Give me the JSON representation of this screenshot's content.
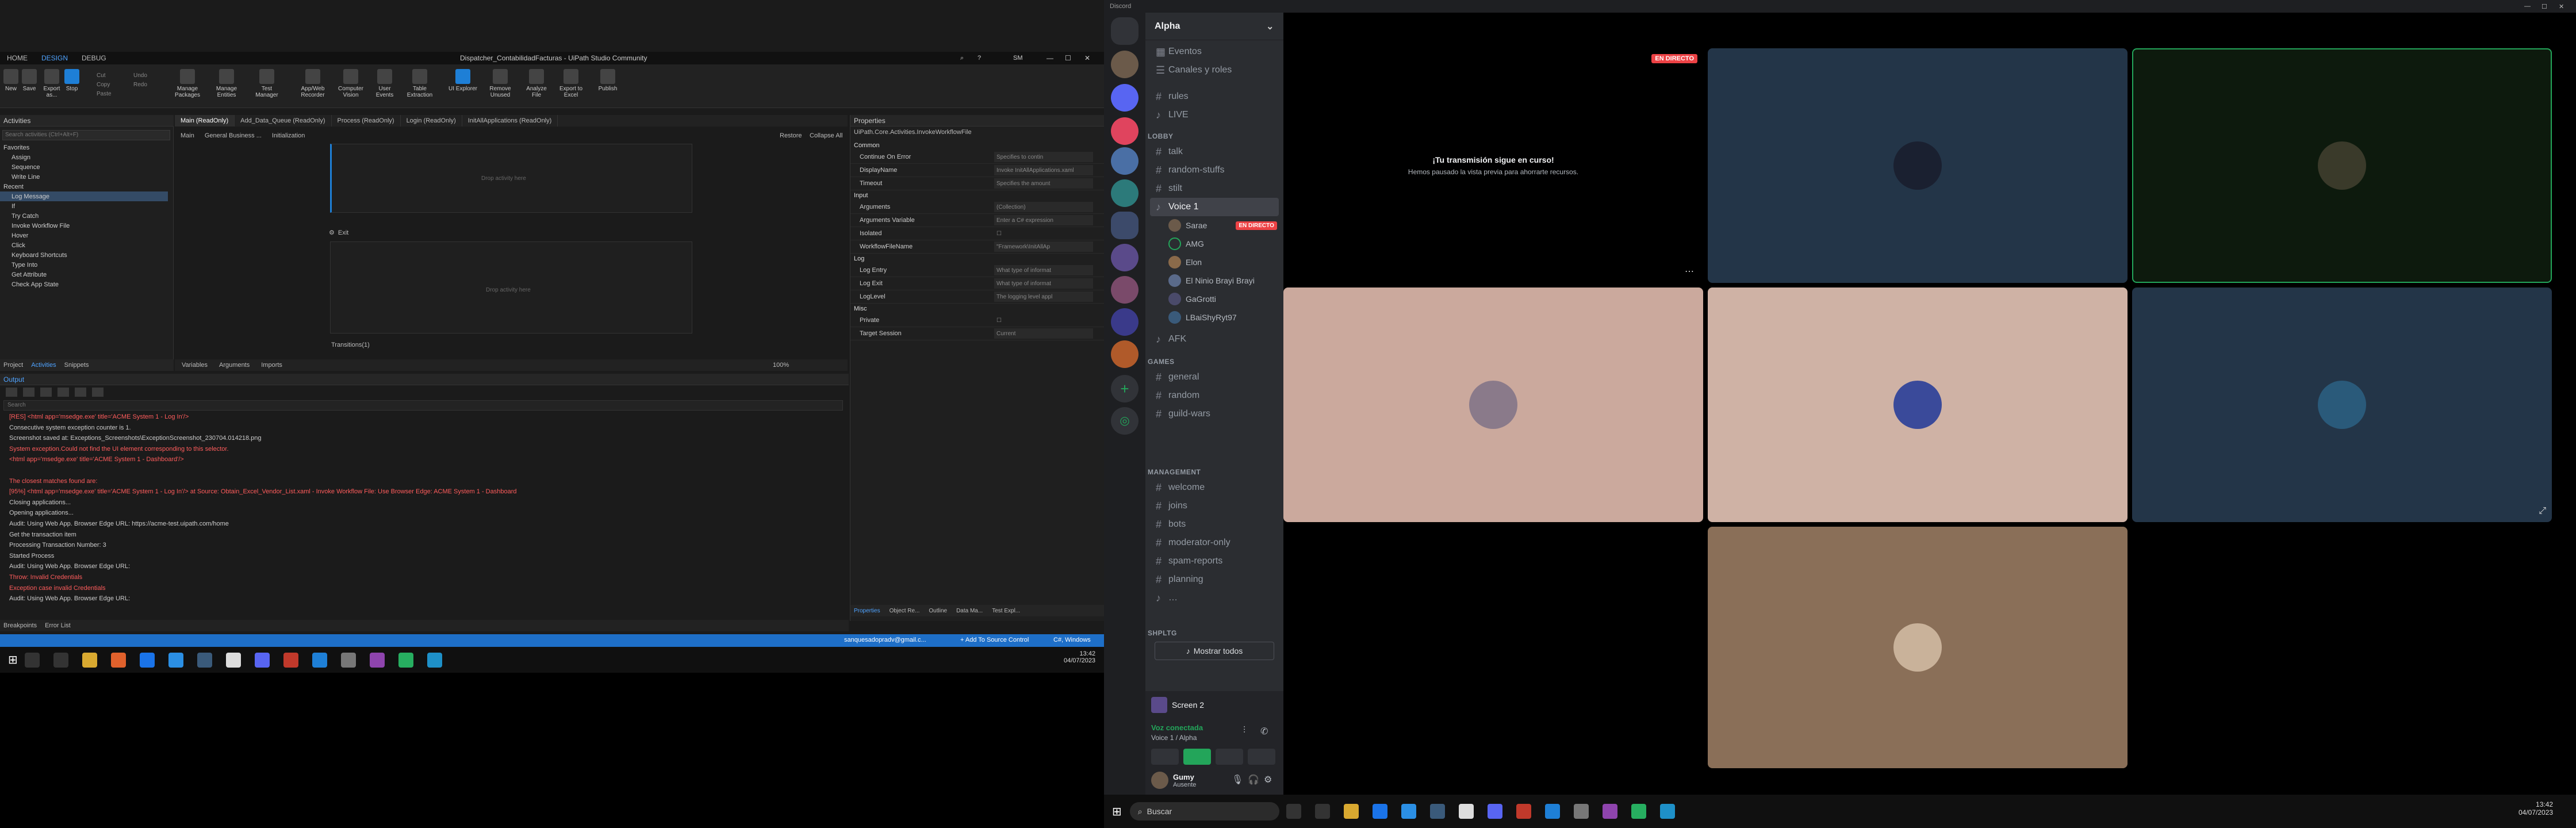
{
  "uipath": {
    "ribbon_tabs": [
      "HOME",
      "DESIGN",
      "DEBUG"
    ],
    "window_title": "Dispatcher_ContabilidadFacturas - UiPath Studio Community",
    "user_initials": "SM",
    "ribbon": {
      "new": "New",
      "save": "Save",
      "export": "Export as...",
      "stop": "Stop",
      "cut": "Cut",
      "copy": "Copy",
      "paste": "Paste",
      "undo": "Undo",
      "redo": "Redo",
      "manage_packages": "Manage Packages",
      "manage_entities": "Manage Entities",
      "test_manager": "Test Manager",
      "app_web_recorder": "App/Web Recorder",
      "computer_vision": "Computer Vision",
      "user_events": "User Events",
      "table_extraction": "Table Extraction",
      "ui_explorer": "UI Explorer",
      "remove_unused": "Remove Unused",
      "analyze_file": "Analyze File",
      "export_to_excel": "Export to Excel",
      "publish": "Publish"
    },
    "activities_panel": {
      "title": "Activities",
      "search_placeholder": "Search activities (Ctrl+Alt+F)",
      "favorites_label": "Favorites",
      "favorites": [
        "Assign",
        "Sequence",
        "Write Line"
      ],
      "recent_label": "Recent",
      "recent": [
        "Log Message",
        "If",
        "Try Catch",
        "Invoke Workflow File",
        "Hover",
        "Click",
        "Keyboard Shortcuts",
        "Type Into",
        "Get Attribute",
        "Check App State"
      ],
      "bottom_tabs": [
        "Project",
        "Activities",
        "Snippets"
      ]
    },
    "doc_tabs": [
      "Main (ReadOnly)",
      "Add_Data_Queue (ReadOnly)",
      "Process (ReadOnly)",
      "Login (ReadOnly)",
      "InitAllApplications (ReadOnly)"
    ],
    "breadcrumb": [
      "Main",
      "General Business ...",
      "Initialization"
    ],
    "designer": {
      "restore": "Restore",
      "collapse_all": "Collapse All",
      "drop_hint_1": "Drop activity here",
      "exit_label": "Exit",
      "drop_hint_2": "Drop activity here",
      "transitions": "Transitions(1)",
      "bottom_tabs": [
        "Variables",
        "Arguments",
        "Imports"
      ],
      "zoom": "100%"
    },
    "properties": {
      "title": "Properties",
      "subtitle": "UiPath.Core.Activities.InvokeWorkflowFile",
      "sections": [
        {
          "name": "Common",
          "rows": [
            [
              "Continue On Error",
              "Specifies to contin"
            ],
            [
              "DisplayName",
              "Invoke InitAllApplications.xaml"
            ],
            [
              "Timeout",
              "Specifies the amount"
            ]
          ]
        },
        {
          "name": "Input",
          "rows": [
            [
              "Arguments",
              "(Collection)"
            ],
            [
              "Arguments Variable",
              "Enter a C# expression"
            ],
            [
              "Isolated",
              ""
            ],
            [
              "WorkflowFileName",
              "\"Framework\\InitAllAp"
            ]
          ]
        },
        {
          "name": "Log",
          "rows": [
            [
              "Log Entry",
              "What type of informat"
            ],
            [
              "Log Exit",
              "What type of informat"
            ],
            [
              "LogLevel",
              "The logging level appl"
            ]
          ]
        },
        {
          "name": "Misc",
          "rows": [
            [
              "Private",
              ""
            ]
          ]
        },
        {
          "name": "",
          "rows": [
            [
              "Target Session",
              "Current"
            ]
          ]
        }
      ],
      "bottom_tabs": [
        "Properties",
        "Object Re...",
        "Outline",
        "Data Ma...",
        "Test Expl..."
      ]
    },
    "output": {
      "title": "Output",
      "search_placeholder": "Search",
      "lines": [
        {
          "t": "err",
          "s": "[RES] <html app='msedge.exe' title='ACME System 1 - Log In'/>"
        },
        {
          "t": "info",
          "s": "Consecutive system exception counter is 1."
        },
        {
          "t": "info",
          "s": "Screenshot saved at: Exceptions_Screenshots\\ExceptionScreenshot_230704.014218.png"
        },
        {
          "t": "err",
          "s": "System exception.Could not find the UI element corresponding to this selector."
        },
        {
          "t": "err",
          "s": "<html app='msedge.exe' title='ACME System 1 - Dashboard'/>"
        },
        {
          "t": "err",
          "s": ""
        },
        {
          "t": "err",
          "s": "The closest matches found are:"
        },
        {
          "t": "err",
          "s": "[95%] <html app='msedge.exe' title='ACME System 1 - Log In'/> at Source: Obtain_Excel_Vendor_List.xaml - Invoke Workflow File: Use Browser Edge: ACME System 1 - Dashboard"
        },
        {
          "t": "info",
          "s": "Closing applications..."
        },
        {
          "t": "info",
          "s": "Opening applications..."
        },
        {
          "t": "info",
          "s": "Audit: Using Web App. Browser Edge URL: https://acme-test.uipath.com/home"
        },
        {
          "t": "info",
          "s": "Get the transaction item"
        },
        {
          "t": "info",
          "s": "Processing Transaction Number: 3"
        },
        {
          "t": "info",
          "s": "Started Process"
        },
        {
          "t": "info",
          "s": "Audit: Using Web App. Browser Edge URL:"
        },
        {
          "t": "err",
          "s": "Throw: Invalid Credentials"
        },
        {
          "t": "err",
          "s": "Exception case invalid Credentials"
        },
        {
          "t": "info",
          "s": "Audit: Using Web App. Browser Edge URL:"
        }
      ],
      "bottom_tabs": [
        "Breakpoints",
        "Error List"
      ]
    },
    "status_bar": {
      "email": "sanquesadopradv@gmail.c...",
      "source_control": "+ Add To Source Control",
      "runtime": "C#, Windows"
    },
    "clock": {
      "time": "13:42",
      "date": "04/07/2023"
    }
  },
  "discord": {
    "app_title": "Discord",
    "server_name": "Alpha",
    "top_links": [
      "Eventos",
      "Canales y roles"
    ],
    "free_channels": [
      "rules",
      "LIVE"
    ],
    "categories": {
      "lobby": "LOBBY",
      "games": "GAMES",
      "management": "MANAGEMENT",
      "shpltg": "SHPLTG"
    },
    "lobby_channels": [
      "talk",
      "random-stuffs",
      "stilt"
    ],
    "voice_channel": "Voice 1",
    "voice_users": [
      {
        "name": "Sarae",
        "live": "EN DIRECTO"
      },
      {
        "name": "AMG"
      },
      {
        "name": "Elon"
      },
      {
        "name": "El Ninio Brayi Brayi"
      },
      {
        "name": "GaGrotti"
      },
      {
        "name": "LBaiShyRyt97"
      }
    ],
    "afk_channel": "AFK",
    "game_channels": [
      "general",
      "random",
      "guild-wars"
    ],
    "management_channels": [
      "welcome",
      "joins",
      "bots",
      "moderator-only",
      "spam-reports",
      "planning"
    ],
    "extra_channel": "…",
    "show_all": "Mostrar todos",
    "screen_share": {
      "label": "Screen 2"
    },
    "voice_status": {
      "status": "Voz conectada",
      "channel": "Voice 1 / Alpha"
    },
    "user": {
      "name": "Gumy",
      "status": "Ausente"
    },
    "stage": {
      "live_badge": "EN DIRECTO",
      "stream_msg_title": "¡Tu transmisión sigue en curso!",
      "stream_msg_body": "Hemos pausado la vista previa para ahorrarte recursos."
    },
    "taskbar_search": "Buscar",
    "clock": {
      "time": "13:42",
      "date": "04/07/2023"
    },
    "colors": {
      "accent": "#5865f2",
      "live": "#ed4245",
      "connected": "#23a55a"
    }
  }
}
